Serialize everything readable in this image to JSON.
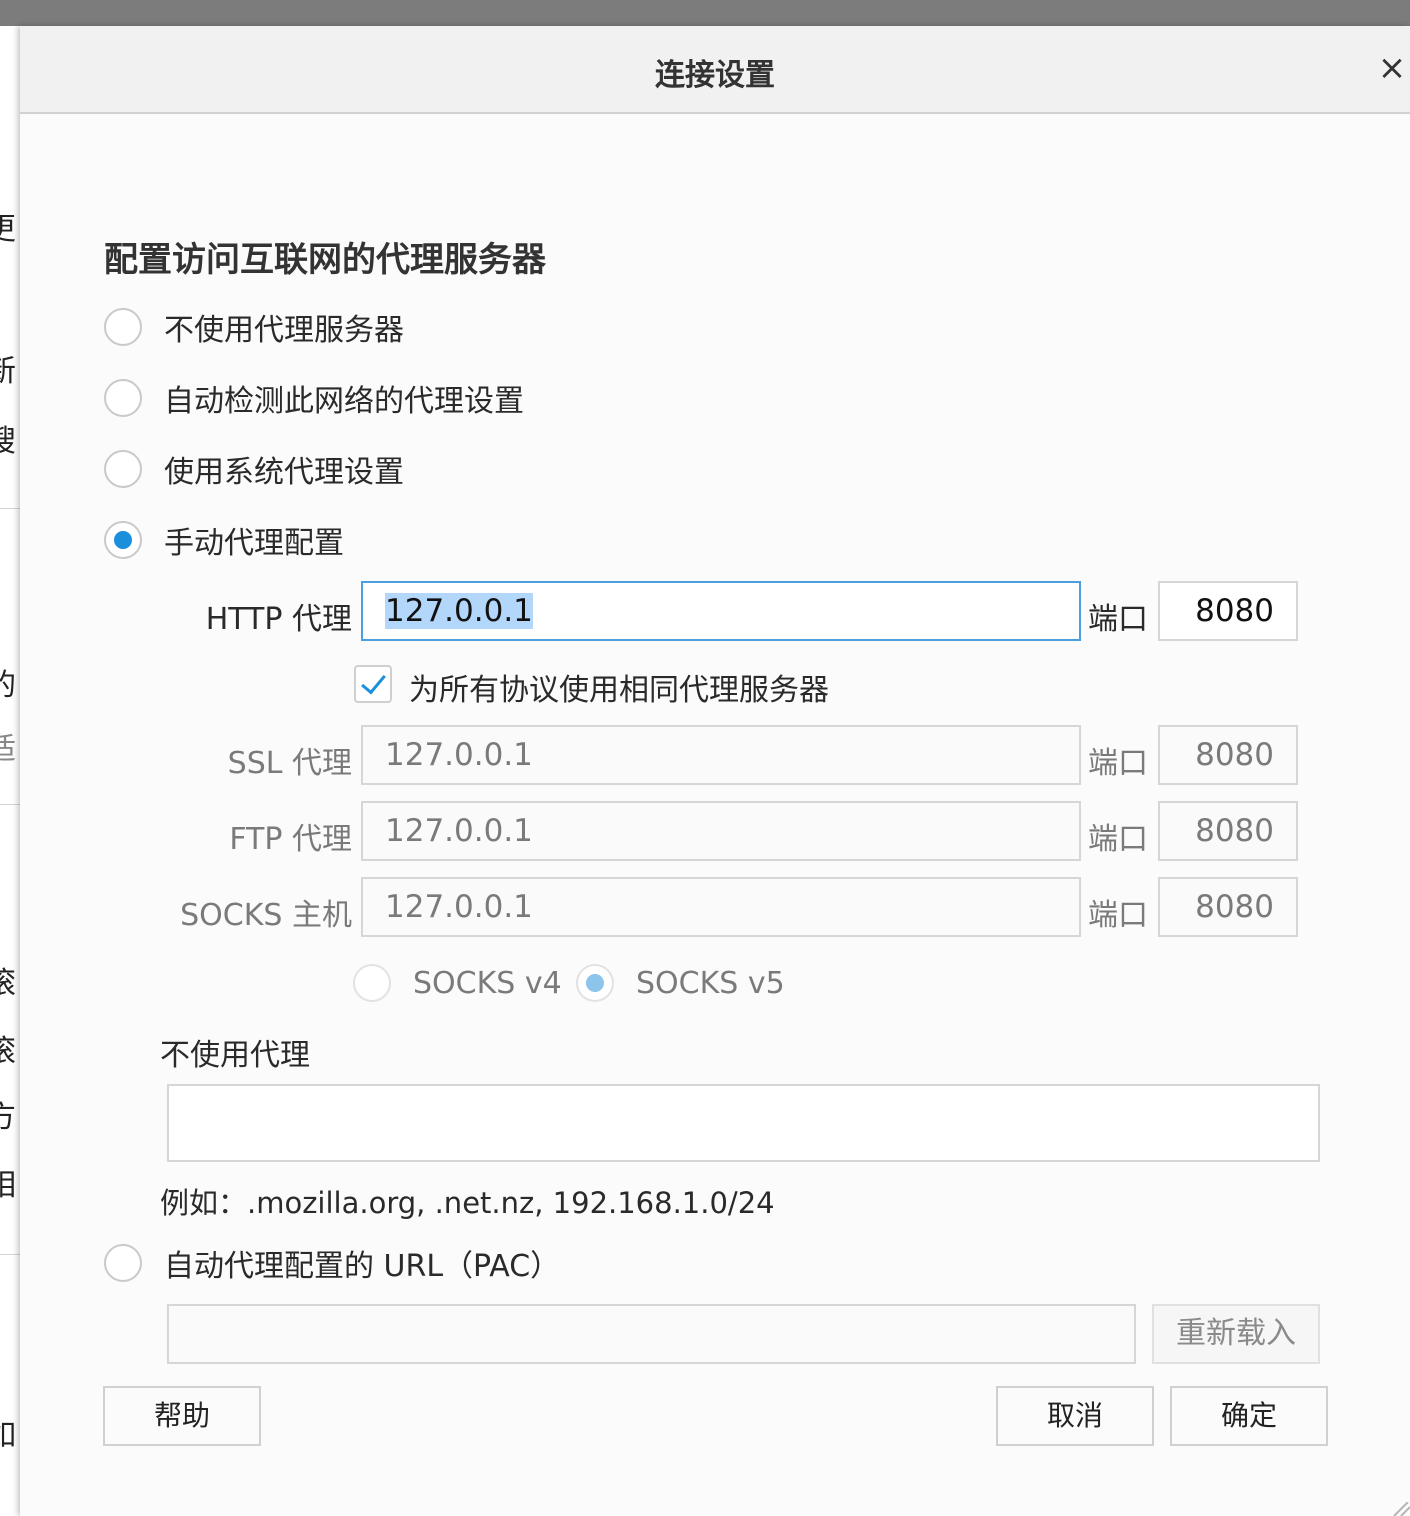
{
  "background_fragments": [
    "更",
    ",",
    "新",
    "搜",
    "的",
    "适",
    "滚",
    "滚",
    "方",
    "相",
    "如"
  ],
  "dialog": {
    "title": "连接设置",
    "close_icon": "×",
    "heading": "配置访问互联网的代理服务器",
    "proxy_modes": [
      {
        "label": "不使用代理服务器",
        "checked": false
      },
      {
        "label": "自动检测此网络的代理设置",
        "checked": false
      },
      {
        "label": "使用系统代理设置",
        "checked": false
      },
      {
        "label": "手动代理配置",
        "checked": true
      }
    ],
    "manual": {
      "port_label": "端口",
      "http": {
        "label": "HTTP 代理",
        "value": "127.0.0.1",
        "port": "8080"
      },
      "same_proxy": {
        "label": "为所有协议使用相同代理服务器",
        "checked": true
      },
      "ssl": {
        "label": "SSL 代理",
        "value": "127.0.0.1",
        "port": "8080"
      },
      "ftp": {
        "label": "FTP 代理",
        "value": "127.0.0.1",
        "port": "8080"
      },
      "socks": {
        "label": "SOCKS 主机",
        "value": "127.0.0.1",
        "port": "8080"
      },
      "socks_versions": [
        {
          "label": "SOCKS v4",
          "checked": false
        },
        {
          "label": "SOCKS v5",
          "checked": true
        }
      ]
    },
    "no_proxy": {
      "label": "不使用代理",
      "value": "",
      "example": "例如：.mozilla.org, .net.nz, 192.168.1.0/24"
    },
    "pac": {
      "label": "自动代理配置的 URL（PAC）",
      "checked": false,
      "value": "",
      "reload_label": "重新载入"
    },
    "buttons": {
      "help": "帮助",
      "cancel": "取消",
      "ok": "确定"
    }
  },
  "colors": {
    "accent": "#1a8fdc",
    "selection": "#b3d6fb",
    "focus_border": "#4a9fe0"
  }
}
